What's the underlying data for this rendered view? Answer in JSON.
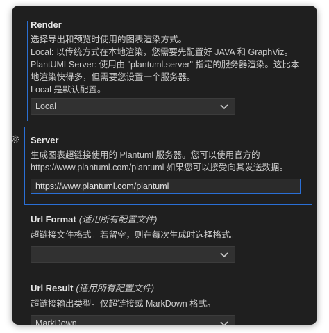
{
  "render": {
    "title": "Render",
    "description": "选择导出和预览时使用的图表渲染方式。\nLocal: 以传统方式在本地渲染，您需要先配置好 JAVA 和 GraphViz。\nPlantUMLServer: 使用由 \"plantuml.server\" 指定的服务器渲染。这比本地渲染快得多，但需要您设置一个服务器。\nLocal 是默认配置。",
    "selected": "Local"
  },
  "server": {
    "title": "Server",
    "description": "生成图表超链接使用的 Plantuml 服务器。您可以使用官方的\nhttps://www.plantuml.com/plantuml 如果您可以接受向其发送数据。",
    "value": "https://www.plantuml.com/plantuml"
  },
  "url_format": {
    "title": "Url Format",
    "scope": "(适用所有配置文件)",
    "description": "超链接文件格式。若留空，则在每次生成时选择格式。",
    "selected": ""
  },
  "url_result": {
    "title": "Url Result",
    "scope": "(适用所有配置文件)",
    "description": "超链接输出类型。仅超链接或 MarkDown 格式。",
    "selected": "MarkDown"
  },
  "colors": {
    "focus_border": "#2a6fd6",
    "background": "#1f1f1f",
    "dropdown_bg": "#313131"
  },
  "icons": [
    "chevron-down-icon",
    "gear-icon"
  ]
}
